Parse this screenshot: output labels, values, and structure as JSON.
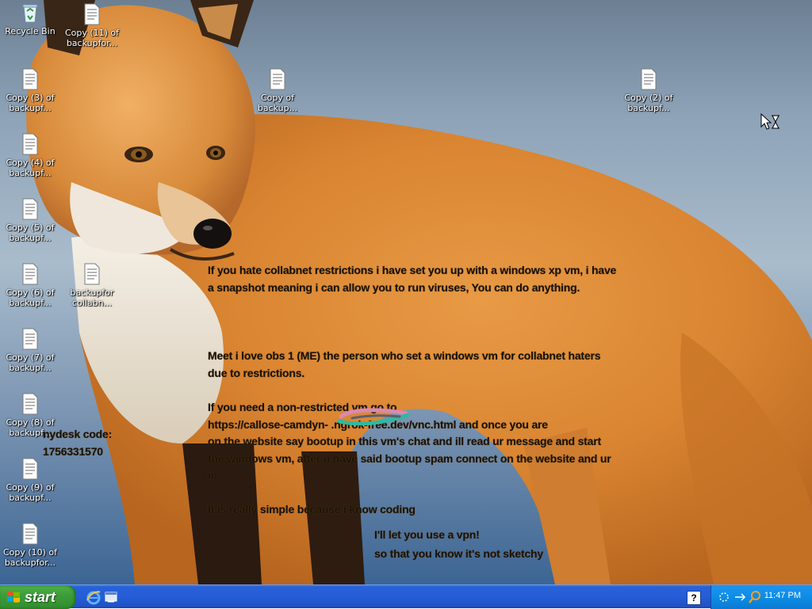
{
  "desktop": {
    "icons": [
      {
        "label": "Recycle Bin",
        "type": "recycle-bin"
      },
      {
        "label": "Copy (11) of\nbackupfor...",
        "type": "document"
      },
      {
        "label": "Copy (3) of\nbackupf...",
        "type": "document"
      },
      {
        "label": "Copy of\nbackup...",
        "type": "document"
      },
      {
        "label": "Copy (2) of\nbackupf...",
        "type": "document"
      },
      {
        "label": "Copy (4) of\nbackupf...",
        "type": "document"
      },
      {
        "label": "Copy (5) of\nbackupf...",
        "type": "document"
      },
      {
        "label": "Copy (6) of\nbackupf...",
        "type": "document"
      },
      {
        "label": "backupfor\ncollabn...",
        "type": "document"
      },
      {
        "label": "Copy (7) of\nbackupf...",
        "type": "document"
      },
      {
        "label": "Copy (8) of\nbackupf...",
        "type": "document"
      },
      {
        "label": "Copy (9) of\nbackupf...",
        "type": "document"
      },
      {
        "label": "Copy (10) of\nbackupfor...",
        "type": "document"
      }
    ],
    "notes": {
      "intro": "If you hate collabnet restrictions i have set you up with a windows xp vm, i have\na snapshot meaning i can allow you to run viruses, You can do anything.",
      "credit": "Meet i love obs   1 (ME) the person who set a windows vm for collabnet haters\ndue to restrictions.",
      "instructions": "If you need a non-restricted vm go to\nhttps://callose-camdyn-                .ngrok-free.dev/vnc.html and once you are\non the website say bootup in this vm's chat and ill read ur message and start\nthe windows vm, after u have said bootup spam connect on the website and ur\nin.",
      "anydesk": "nydesk code:\n  1756331570",
      "simple": "It is really simple because i know coding",
      "vpn": "I'll let you use a vpn!\nso that you know it's not sketchy"
    }
  },
  "taskbar": {
    "start_label": "start",
    "quick_launch": [
      "internet-explorer-icon",
      "show-desktop-icon"
    ],
    "help_label": "?",
    "clock": "11:47 PM"
  }
}
